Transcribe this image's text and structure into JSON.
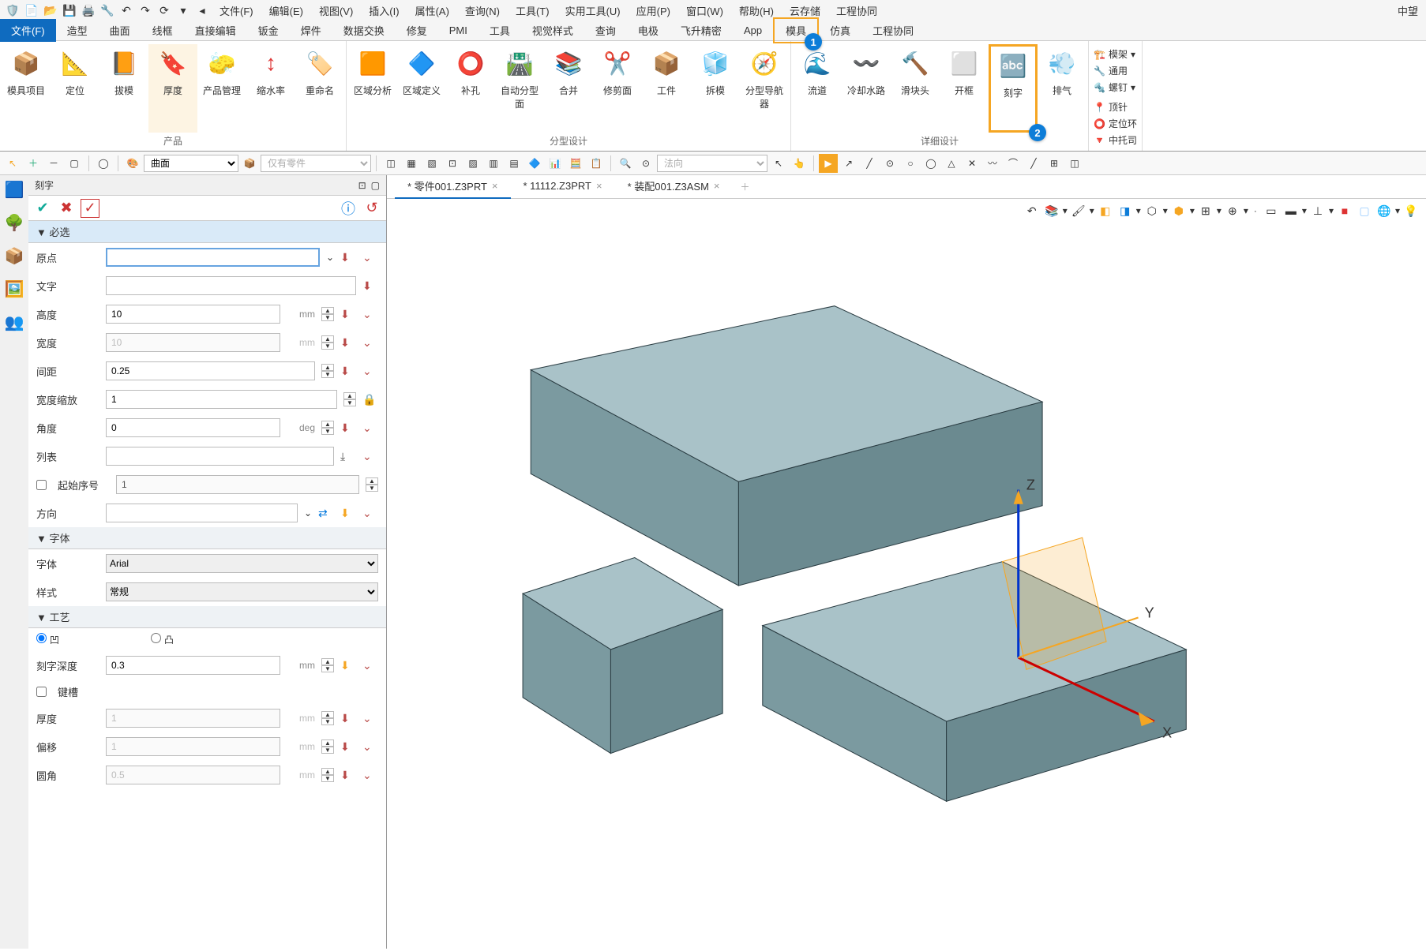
{
  "app_title": "中望",
  "menubar": {
    "items": [
      "文件(F)",
      "编辑(E)",
      "视图(V)",
      "插入(I)",
      "属性(A)",
      "查询(N)",
      "工具(T)",
      "实用工具(U)",
      "应用(P)",
      "窗口(W)",
      "帮助(H)",
      "云存储",
      "工程协同"
    ]
  },
  "ribbon_tabs": [
    "文件(F)",
    "造型",
    "曲面",
    "线框",
    "直接编辑",
    "钣金",
    "焊件",
    "数据交换",
    "修复",
    "PMI",
    "工具",
    "视觉样式",
    "查询",
    "电极",
    "飞升精密",
    "App",
    "模具",
    "仿真",
    "工程协同"
  ],
  "ribbon_tabs_active": "文件(F)",
  "ribbon_tabs_highlight": "模具",
  "ribbon_groups": {
    "产品": [
      "模具项目",
      "定位",
      "拔模",
      "厚度",
      "产品管理",
      "缩水率",
      "重命名"
    ],
    "分型设计": [
      "区域分析",
      "区域定义",
      "补孔",
      "自动分型面",
      "合并",
      "修剪面",
      "工件",
      "拆模",
      "分型导航器"
    ],
    "详细设计": [
      "流道",
      "冷却水路",
      "滑块头",
      "开框",
      "刻字",
      "排气"
    ],
    "mini": [
      "模架",
      "通用",
      "螺钉",
      "顶针",
      "定位环",
      "中托司"
    ]
  },
  "ribbon_highlight_button": "刻字",
  "sec_toolbar": {
    "sel1": "曲面",
    "sel2": "仅有零件",
    "sel3": "法向"
  },
  "panel": {
    "title": "刻字",
    "sections": {
      "mandatory": "▼ 必选",
      "font": "▼ 字体",
      "process": "▼ 工艺"
    },
    "fields": {
      "origin_lbl": "原点",
      "origin_val": "",
      "text_lbl": "文字",
      "text_val": "",
      "height_lbl": "高度",
      "height_val": "10",
      "height_unit": "mm",
      "width_lbl": "宽度",
      "width_val": "10",
      "width_unit": "mm",
      "spacing_lbl": "间距",
      "spacing_val": "0.25",
      "wscale_lbl": "宽度缩放",
      "wscale_val": "1",
      "angle_lbl": "角度",
      "angle_val": "0",
      "angle_unit": "deg",
      "list_lbl": "列表",
      "list_val": "",
      "startnum_lbl": "起始序号",
      "startnum_val": "1",
      "dir_lbl": "方向",
      "dir_val": "",
      "font_lbl": "字体",
      "font_val": "Arial",
      "style_lbl": "样式",
      "style_val": "常规",
      "concave_lbl": "凹",
      "convex_lbl": "凸",
      "depth_lbl": "刻字深度",
      "depth_val": "0.3",
      "depth_unit": "mm",
      "keyway_lbl": "键槽",
      "thick_lbl": "厚度",
      "thick_val": "1",
      "thick_unit": "mm",
      "offset_lbl": "偏移",
      "offset_val": "1",
      "offset_unit": "mm",
      "fillet_lbl": "圆角",
      "fillet_val": "0.5",
      "fillet_unit": "mm"
    }
  },
  "doc_tabs": [
    {
      "label": "* 零件001.Z3PRT",
      "active": true
    },
    {
      "label": "* 11112.Z3PRT",
      "active": false
    },
    {
      "label": "* 装配001.Z3ASM",
      "active": false
    }
  ],
  "axes": {
    "x": "X",
    "y": "Y",
    "z": "Z"
  }
}
